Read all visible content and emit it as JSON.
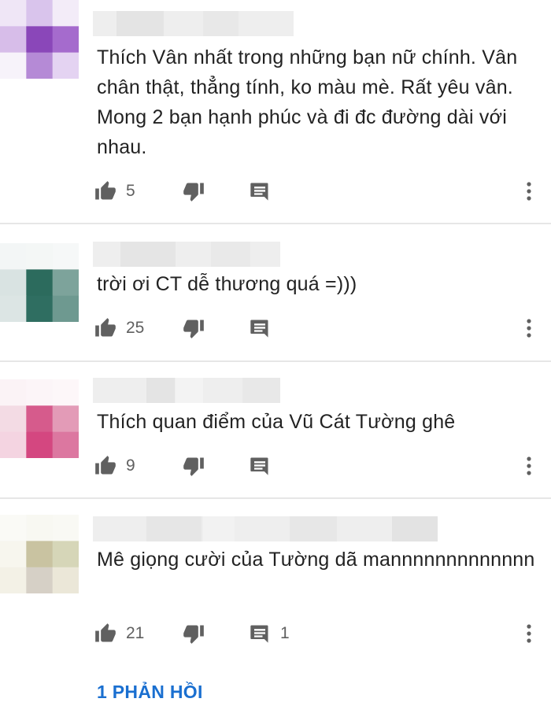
{
  "comments": [
    {
      "text": "Thích Vân nhất trong những bạn nữ chính. Vân chân thật, thẳng tính, ko màu mè. Rất yêu vân. Mong 2 bạn hạnh phúc và đi đc đường dài với nhau.",
      "likes": "5",
      "replies": "",
      "avatar_colors": [
        "#efe6f6",
        "#d9c4ec",
        "#f3ecf8",
        "#d7bde9",
        "#8a47b9",
        "#a56bcd",
        "#f7f3fa",
        "#b58ad6",
        "#e4d3f2"
      ]
    },
    {
      "text": "trời ơi CT dễ thương quá =)))",
      "likes": "25",
      "replies": "",
      "avatar_colors": [
        "#f3f6f6",
        "#f4f7f6",
        "#f6f8f8",
        "#d9e3e2",
        "#2c6b5d",
        "#7da39b",
        "#dce5e4",
        "#2f6e61",
        "#6e9990"
      ]
    },
    {
      "text": "Thích quan điểm của Vũ Cát Tường ghê",
      "likes": "9",
      "replies": "",
      "avatar_colors": [
        "#fbf3f6",
        "#fcf5f8",
        "#fdf7f9",
        "#f3dbe4",
        "#d65b8c",
        "#e39bb7",
        "#f4d4e1",
        "#d44780",
        "#dc77a0"
      ]
    },
    {
      "text": "Mê giọng cười của Tường dã mannnnnnnnnnnnn",
      "likes": "21",
      "replies": "1",
      "avatar_colors": [
        "#fafaf6",
        "#f8f8f2",
        "#f9f9f4",
        "#f7f6ee",
        "#c9c3a1",
        "#d6d6b8",
        "#f3f1e6",
        "#d6d0c6",
        "#ebe7d8"
      ]
    }
  ],
  "icons": {
    "like": "thumbs-up-icon",
    "dislike": "thumbs-down-icon",
    "reply": "reply-icon",
    "more": "more-vert-icon"
  },
  "colors": {
    "text": "#222222",
    "icon": "#606060",
    "link": "#1a6fd0"
  },
  "view_replies": "1 PHẢN HỒI"
}
